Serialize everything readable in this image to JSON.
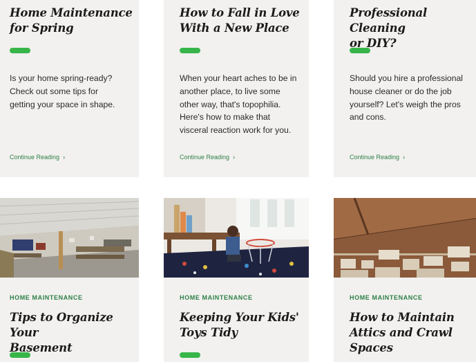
{
  "cards_top": [
    {
      "title_lines": [
        "Home Maintenance",
        "for Spring"
      ],
      "excerpt_lines": [
        "Is your home spring-ready?",
        "Check out some tips for",
        "getting your space in shape."
      ],
      "read_more": "Continue Reading",
      "chevron": "›"
    },
    {
      "title_lines": [
        "How to Fall in Love",
        "With a New Place"
      ],
      "excerpt_lines": [
        "When your heart aches to be in",
        "another place, to live some",
        "other way, that's topophilia.",
        "Here's how to make that",
        "visceral reaction work for you."
      ],
      "read_more": "Continue Reading",
      "chevron": "›"
    },
    {
      "title_lines": [
        "Professional Cleaning",
        "or DIY?"
      ],
      "excerpt_lines": [
        "Should you hire a professional",
        "house cleaner or do the job",
        "yourself? Let's weigh the pros",
        "and cons."
      ],
      "read_more": "Continue Reading",
      "chevron": "›"
    }
  ],
  "cards_bottom": [
    {
      "category": "HOME MAINTENANCE",
      "title_lines": [
        "Tips to Organize Your",
        "Basement"
      ]
    },
    {
      "category": "HOME MAINTENANCE",
      "title_lines": [
        "Keeping Your Kids'",
        "Toys Tidy"
      ]
    },
    {
      "category": "HOME MAINTENANCE",
      "title_lines": [
        "How to Maintain",
        "Attics and Crawl",
        "Spaces"
      ]
    }
  ],
  "colors": {
    "card_bg": "#f2f1ef",
    "accent_green": "#38b549",
    "link_green": "#2e7f47",
    "title": "#1b1b1b"
  }
}
